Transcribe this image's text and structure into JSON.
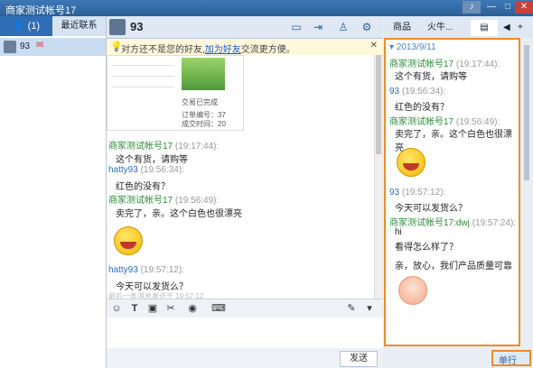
{
  "window": {
    "title": "商家测试帐号17"
  },
  "left": {
    "tabs": {
      "contacts": "(1)",
      "recent": "最近联系"
    },
    "contact": {
      "name": "93"
    }
  },
  "chat": {
    "contact_name": "93",
    "notice": {
      "text": "对方还不是您的好友,",
      "link": "加为好友",
      "suffix": "交流更方便。"
    },
    "card": {
      "status": "交易已完成",
      "order_label": "订单编号：37",
      "count_label": "成交时间：20"
    },
    "messages": [
      {
        "sender": "商家测试帐号17",
        "time": "(19:17:44):",
        "text": "这个有货，请购等"
      },
      {
        "sender": "hatty93",
        "time": "(19:56:34):",
        "text": "红色的没有？"
      },
      {
        "sender": "商家测试帐号17",
        "time": "(19:56:49):",
        "text": "卖完了，亲。这个白色也很漂亮"
      },
      {
        "sender": "hatty93",
        "time": "(19:57:12):",
        "text": "今天可以发货么？"
      }
    ],
    "last_message": "最后一条消息发送于 19:57:12",
    "send_label": "发送"
  },
  "right": {
    "tabs": {
      "goods": "商品",
      "fire": "火牛..."
    },
    "date": "2013/9/11",
    "messages": [
      {
        "sender": "商家测试帐号17",
        "time": "(19:17:44):",
        "text": "这个有货，请购等"
      },
      {
        "sender": "93",
        "time": "(19:56:34):",
        "text": "红色的没有？"
      },
      {
        "sender": "商家测试帐号17",
        "time": "(19:56:49):",
        "text": "卖完了，亲。这个白色也很漂亮"
      },
      {
        "sender": "93",
        "time": "(19:57:12):",
        "text": "今天可以发货么？"
      },
      {
        "sender": "商家测试帐号17:dwj",
        "time": "(19:57:24):",
        "text": "hi"
      }
    ],
    "extra_lines": [
      "看得怎么样了？",
      "亲，放心，我们产品质量可靠"
    ],
    "switch_label": "单行"
  }
}
